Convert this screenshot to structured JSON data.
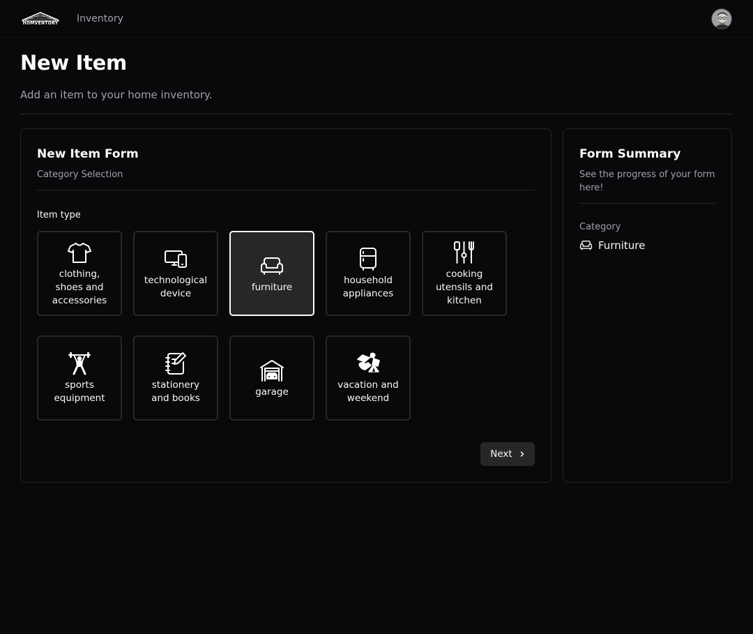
{
  "header": {
    "logo_text": "HOMVENTORY",
    "nav_link": "Inventory"
  },
  "page": {
    "title": "New Item",
    "subtitle": "Add an item to your home inventory."
  },
  "form": {
    "title": "New Item Form",
    "step": "Category Selection",
    "field_label": "Item type",
    "categories": [
      {
        "label": "clothing,\nshoes and\naccessories",
        "icon": "tshirt-icon"
      },
      {
        "label": "technological\ndevice",
        "icon": "devices-icon"
      },
      {
        "label": "furniture",
        "icon": "sofa-icon",
        "selected": true
      },
      {
        "label": "household\nappliances",
        "icon": "fridge-icon"
      },
      {
        "label": "cooking\nutensils and\nkitchen",
        "icon": "utensils-icon"
      },
      {
        "label": "sports\nequipment",
        "icon": "weightlifter-icon"
      },
      {
        "label": "stationery\nand books",
        "icon": "notebook-icon"
      },
      {
        "label": "garage",
        "icon": "garage-icon"
      },
      {
        "label": "vacation and\nweekend",
        "icon": "camping-icon"
      }
    ],
    "next_label": "Next"
  },
  "summary": {
    "title": "Form Summary",
    "subtitle": "See the progress of your form here!",
    "category_label": "Category",
    "category_value": "Furniture"
  },
  "colors": {
    "background": "#09090b",
    "border": "#27272a",
    "muted_text": "#a1a1aa",
    "selected_tile": "#27272a",
    "text": "#fafafa"
  }
}
